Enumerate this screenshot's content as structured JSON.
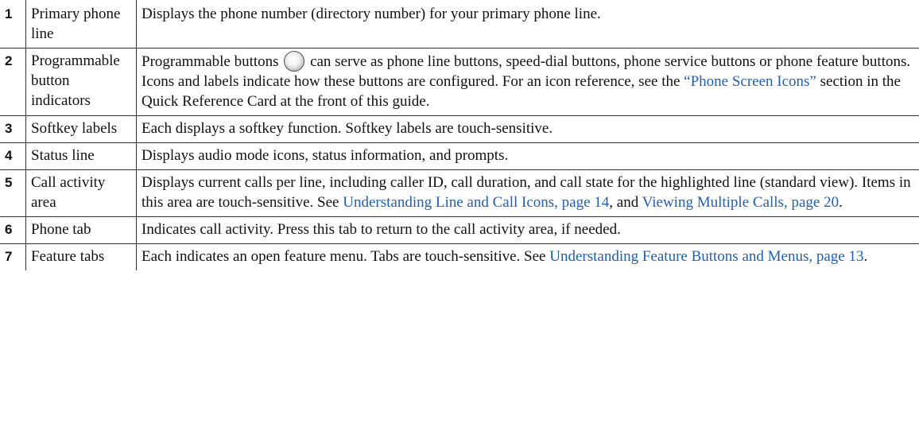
{
  "rows": [
    {
      "num": "1",
      "term": "Primary phone line",
      "desc": "Displays the phone number (directory number) for your primary phone line."
    },
    {
      "num": "2",
      "term": "Programmable button indicators",
      "desc_pre": "Programmable buttons",
      "icon": "round-phone-button-icon",
      "desc_mid": "can serve as phone line buttons, speed-dial buttons, phone service buttons or phone feature buttons. Icons and labels indicate how these buttons are configured. For an icon reference, see the",
      "link1": "“Phone Screen Icons”",
      "desc_post": "section in the Quick Reference Card at the front of this guide."
    },
    {
      "num": "3",
      "term": "Softkey labels",
      "desc": "Each displays a softkey function. Softkey labels are touch-sensitive."
    },
    {
      "num": "4",
      "term": "Status line",
      "desc": "Displays audio mode icons, status information, and prompts."
    },
    {
      "num": "5",
      "term": "Call activity area",
      "desc_pre": "Displays current calls per line, including caller ID, call duration, and call state for the highlighted line (standard view). Items in this area are touch-sensitive. See",
      "link1": "Understanding Line and Call Icons, page 14",
      "desc_mid": ", and",
      "link2": "Viewing Multiple Calls, page 20",
      "desc_post": "."
    },
    {
      "num": "6",
      "term": "Phone tab",
      "desc": "Indicates call activity. Press this tab to return to the call activity area, if needed."
    },
    {
      "num": "7",
      "term": "Feature tabs",
      "desc_pre": "Each indicates an open feature menu. Tabs are touch-sensitive. See",
      "link1": "Understanding Feature Buttons and Menus, page 13",
      "desc_post": "."
    }
  ]
}
